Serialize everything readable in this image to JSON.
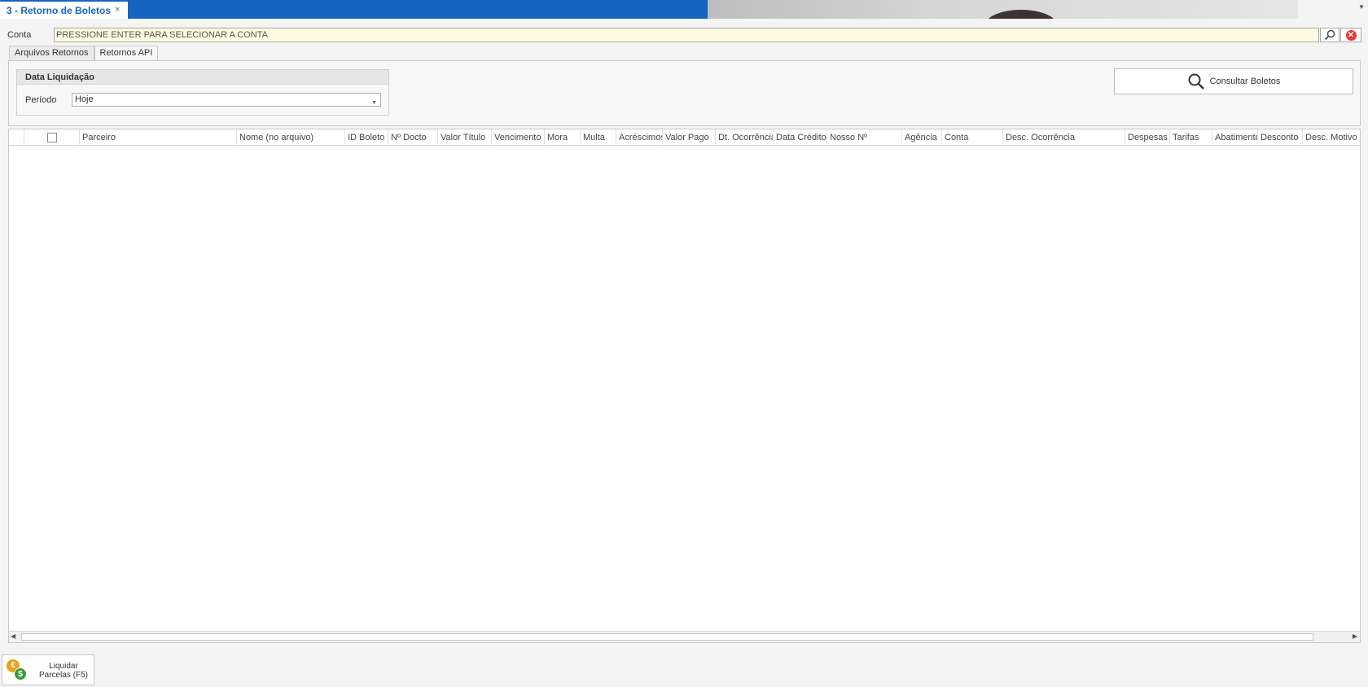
{
  "document_tab": {
    "title": "3 - Retorno de Boletos",
    "close": "×"
  },
  "conta": {
    "label": "Conta",
    "value": "PRESSIONE ENTER PARA SELECIONAR A CONTA"
  },
  "tabs": [
    {
      "label": "Arquivos Retornos"
    },
    {
      "label": "Retornos API"
    }
  ],
  "data_liquidacao": {
    "title": "Data Liquidação",
    "periodo_label": "Período",
    "periodo_value": "Hoje"
  },
  "consultar_button": {
    "label": "Consultar Boletos"
  },
  "grid": {
    "columns": [
      "Parceiro",
      "Nome (no arquivo)",
      "ID Boleto",
      "Nº Docto",
      "Valor Título",
      "Vencimento",
      "Mora",
      "Multa",
      "Acréscimos",
      "Valor Pago",
      "Dt. Ocorrência",
      "Data Crédito",
      "Nosso Nº",
      "Agência",
      "Conta",
      "Desc. Ocorrência",
      "Despesas",
      "Tarifas",
      "Abatimento",
      "Desconto",
      "Desc. Motivo"
    ]
  },
  "liquidar_button": {
    "line1": "Liquidar",
    "line2": "Parcelas (F5)"
  },
  "colors": {
    "accent": "#1565c0",
    "field_highlight": "#fffbe0",
    "clear": "#e53935"
  }
}
